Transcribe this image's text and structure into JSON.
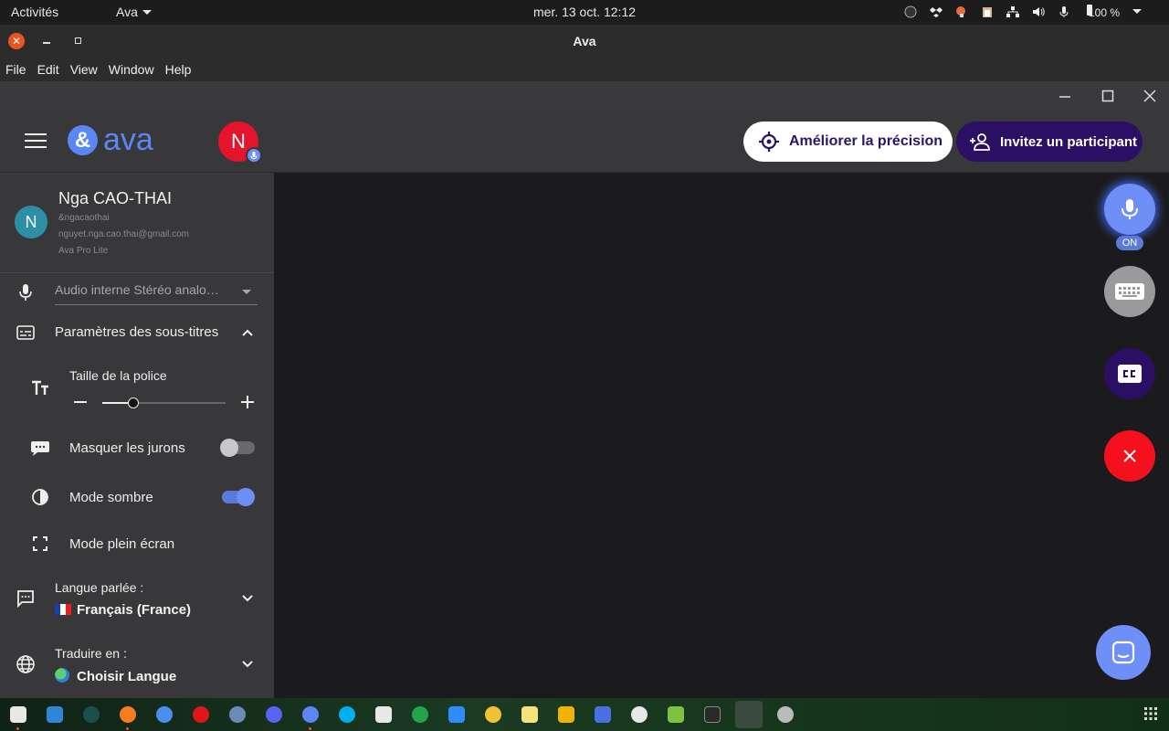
{
  "system_bar": {
    "activities": "Activités",
    "app_menu": "Ava",
    "clock": "mer. 13 oct.  12:12",
    "battery": "100 %"
  },
  "window": {
    "title": "Ava",
    "menu": [
      "File",
      "Edit",
      "View",
      "Window",
      "Help"
    ]
  },
  "header": {
    "logo_symbol": "&",
    "logo_text": "ava",
    "avatar_letter": "N",
    "improve_button": "Améliorer la précision",
    "invite_button": "Invitez un participant"
  },
  "profile": {
    "avatar_letter": "N",
    "name": "Nga CAO-THAI",
    "handle": "&ngacaothai",
    "email": "nguyet.nga.cao.thai@gmail.com",
    "plan": "Ava Pro Lite"
  },
  "audio": {
    "selected": "Audio interne Stéréo analo…"
  },
  "subtitles": {
    "section_label": "Paramètres des sous-titres",
    "font_size_label": "Taille de la police",
    "font_size_level": 0.25,
    "hide_swears_label": "Masquer les jurons",
    "hide_swears_on": false,
    "dark_mode_label": "Mode sombre",
    "dark_mode_on": true,
    "fullscreen_label": "Mode plein écran"
  },
  "language": {
    "spoken_label": "Langue parlée :",
    "spoken_value": "Français (France)",
    "translate_label": "Traduire en :",
    "translate_value": "Choisir Langue"
  },
  "controls": {
    "mic_status": "ON"
  },
  "colors": {
    "accent": "#5b87f5",
    "brand_dark": "#2b0f64",
    "danger": "#f5101e",
    "avatar_red": "#e3142b"
  }
}
